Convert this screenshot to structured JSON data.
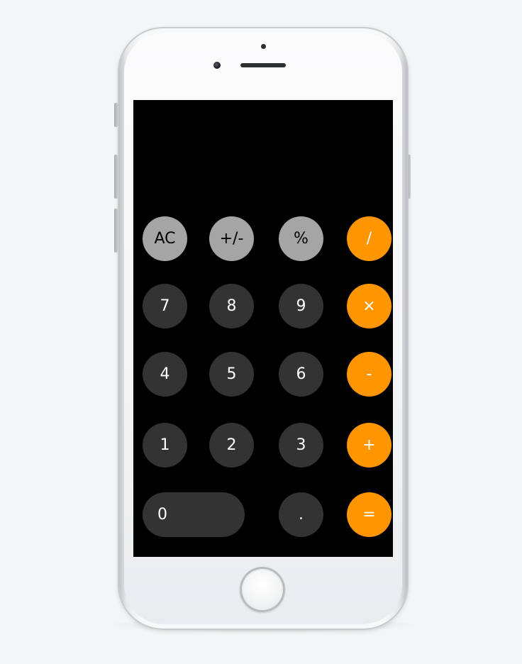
{
  "calculator": {
    "display_value": "",
    "keys": {
      "ac": "AC",
      "sign": "+/-",
      "percent": "%",
      "divide": "/",
      "seven": "7",
      "eight": "8",
      "nine": "9",
      "multiply": "×",
      "four": "4",
      "five": "5",
      "six": "6",
      "subtract": "-",
      "one": "1",
      "two": "2",
      "three": "3",
      "add": "+",
      "zero": "0",
      "decimal": ".",
      "equals": "="
    },
    "colors": {
      "screen_bg": "#000000",
      "function_key": "#a5a5a5",
      "number_key": "#333333",
      "operator_key": "#ff9500"
    }
  },
  "device": {
    "model_icon": "phone-frame-icon",
    "home_button_icon": "home-button-icon"
  }
}
